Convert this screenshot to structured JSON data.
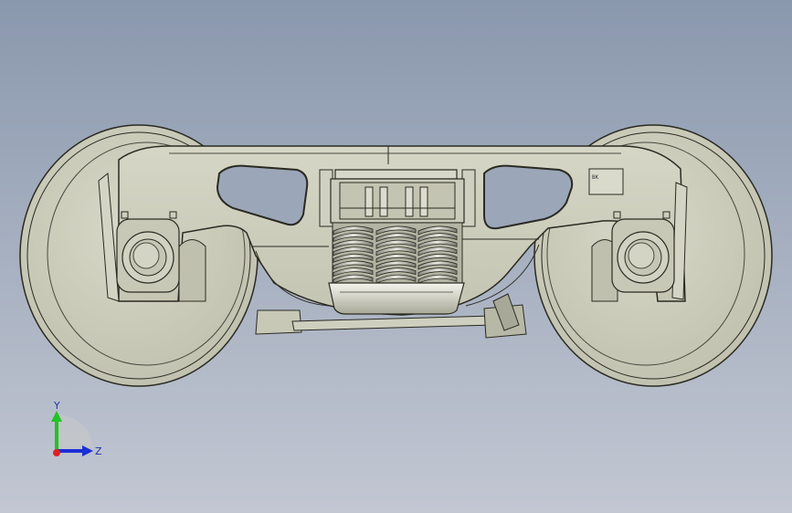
{
  "viewport": {
    "background_top": "#8a98ad",
    "background_bottom": "#c2c7d2"
  },
  "model": {
    "part_color": "#cfcfbf",
    "edge_color": "#2a2a22",
    "name_plate_text": "BK"
  },
  "triad": {
    "y_label": "Y",
    "z_label": "Z",
    "y_color": "#22c322",
    "z_color": "#1a2fd6",
    "x_color": "#e02020"
  }
}
